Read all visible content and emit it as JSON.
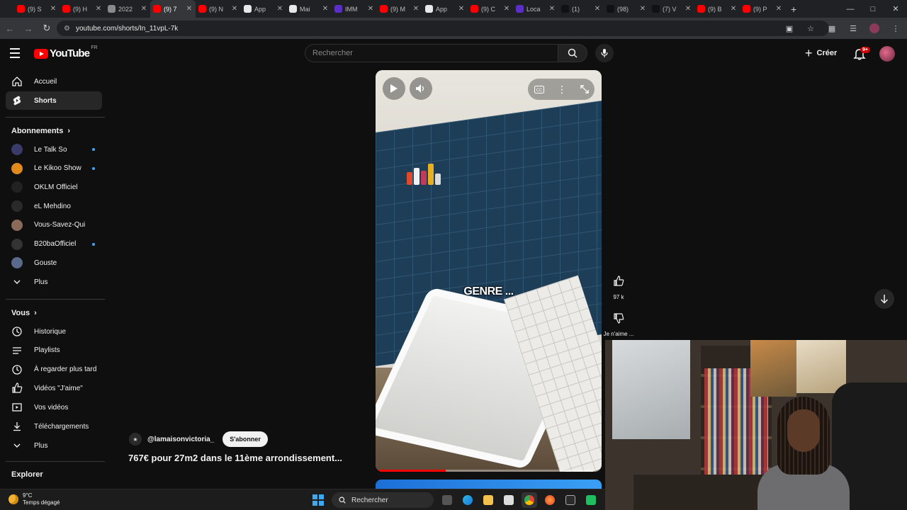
{
  "browser": {
    "tabs": [
      {
        "label": "(9) S",
        "color": "#ff0000"
      },
      {
        "label": "(9) H",
        "color": "#ff0000"
      },
      {
        "label": "2022",
        "color": "#8a8a8a"
      },
      {
        "label": "(9) 7",
        "color": "#ff0000"
      },
      {
        "label": "(9) N",
        "color": "#ff0000"
      },
      {
        "label": "App",
        "color": "#e8e8e8"
      },
      {
        "label": "Mai",
        "color": "#e8e8e8"
      },
      {
        "label": "IMM",
        "color": "#5b2ec7"
      },
      {
        "label": "(9) M",
        "color": "#ff0000"
      },
      {
        "label": "App",
        "color": "#e8e8e8"
      },
      {
        "label": "(9) C",
        "color": "#ff0000"
      },
      {
        "label": "Loca",
        "color": "#5b2ec7"
      },
      {
        "label": "(1)",
        "color": "#111111"
      },
      {
        "label": "(98)",
        "color": "#111111"
      },
      {
        "label": "(7) V",
        "color": "#111111"
      },
      {
        "label": "(9) B",
        "color": "#ff0000"
      },
      {
        "label": "(9) P",
        "color": "#ff0000"
      }
    ],
    "active_tab_index": 3,
    "url": "youtube.com/shorts/In_11vpL-7k"
  },
  "header": {
    "logo_text": "YouTube",
    "country_code": "FR",
    "search_placeholder": "Rechercher",
    "create_label": "Créer",
    "notif_badge": "9+"
  },
  "sidebar": {
    "main": [
      {
        "label": "Accueil",
        "icon": "home-icon"
      },
      {
        "label": "Shorts",
        "icon": "shorts-icon"
      }
    ],
    "subscriptions_title": "Abonnements",
    "subscriptions": [
      {
        "label": "Le Talk So",
        "avatar": "#3b3b6b",
        "live": true
      },
      {
        "label": "Le Kikoo Show",
        "avatar": "#e08a1e",
        "live": true
      },
      {
        "label": "OKLM Officiel",
        "avatar": "#222222",
        "live": false
      },
      {
        "label": "eL Mehdino",
        "avatar": "#2a2a2a",
        "live": false
      },
      {
        "label": "Vous-Savez-Qui",
        "avatar": "#8a6a5a",
        "live": false
      },
      {
        "label": "B20baOfficiel",
        "avatar": "#333333",
        "live": true
      },
      {
        "label": "Gouste",
        "avatar": "#5a6a8a",
        "live": false
      }
    ],
    "more_label": "Plus",
    "you_title": "Vous",
    "you_items": [
      {
        "label": "Historique",
        "icon": "history-icon"
      },
      {
        "label": "Playlists",
        "icon": "playlists-icon"
      },
      {
        "label": "À regarder plus tard",
        "icon": "watch-later-icon"
      },
      {
        "label": "Vidéos \"J'aime\"",
        "icon": "liked-icon"
      },
      {
        "label": "Vos vidéos",
        "icon": "your-videos-icon"
      },
      {
        "label": "Téléchargements",
        "icon": "downloads-icon"
      }
    ],
    "more_label_2": "Plus",
    "explore_title": "Explorer"
  },
  "short": {
    "caption": "GENRE ...",
    "channel": "@lamaisonvictoria_",
    "subscribe_label": "S'abonner",
    "title": "767€ pour 27m2 dans le 11ème arrondissement...",
    "likes": "97 k",
    "dislike_label": "Je n'aime ...",
    "progress": 0.31
  },
  "taskbar": {
    "temperature": "9°C",
    "weather": "Temps dégagé",
    "search_label": "Rechercher"
  }
}
